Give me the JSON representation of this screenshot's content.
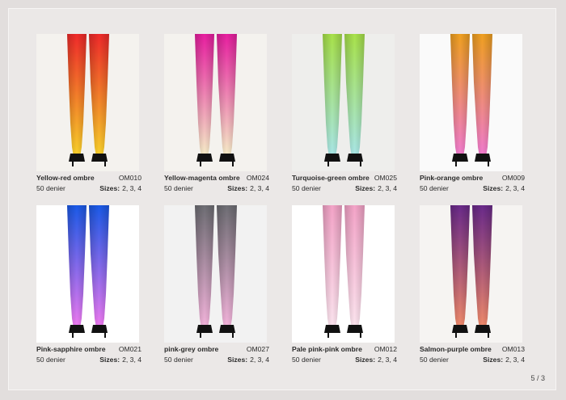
{
  "page_number": "5 / 3",
  "sizes_label": "Sizes:",
  "products": [
    {
      "name": "Yellow-red ombre",
      "code": "OM010",
      "denier": "50 denier",
      "sizes": "2, 3, 4",
      "top": "#f02a2a",
      "bottom": "#f8d22a",
      "bg": "#f4f2ee"
    },
    {
      "name": "Yellow-magenta ombre",
      "code": "OM024",
      "denier": "50 denier",
      "sizes": "2, 3, 4",
      "top": "#e81ea0",
      "bottom": "#f6efc8",
      "bg": "#f4f2ee"
    },
    {
      "name": "Turquoise-green ombre",
      "code": "OM025",
      "denier": "50 denier",
      "sizes": "2, 3, 4",
      "top": "#a8e24a",
      "bottom": "#a8e6e8",
      "bg": "#eeeeec"
    },
    {
      "name": "Pink-orange ombre",
      "code": "OM009",
      "denier": "50 denier",
      "sizes": "2, 3, 4",
      "top": "#f0a020",
      "bottom": "#f07ad0",
      "bg": "#fafafa"
    },
    {
      "name": "Pink-sapphire ombre",
      "code": "OM021",
      "denier": "50 denier",
      "sizes": "2, 3, 4",
      "top": "#1a5ae8",
      "bottom": "#f07af0",
      "bg": "#ffffff"
    },
    {
      "name": "pink-grey ombre",
      "code": "OM027",
      "denier": "50 denier",
      "sizes": "2, 3, 4",
      "top": "#6e6e74",
      "bottom": "#f4b4dc",
      "bg": "#f2f2f2"
    },
    {
      "name": "Pale pink-pink ombre",
      "code": "OM012",
      "denier": "50 denier",
      "sizes": "2, 3, 4",
      "top": "#f4a4c8",
      "bottom": "#fbe4ee",
      "bg": "#ffffff"
    },
    {
      "name": "Salmon-purple ombre",
      "code": "OM013",
      "denier": "50 denier",
      "sizes": "2, 3, 4",
      "top": "#6a2a8a",
      "bottom": "#f08a6a",
      "bg": "#f6f4f2"
    }
  ]
}
